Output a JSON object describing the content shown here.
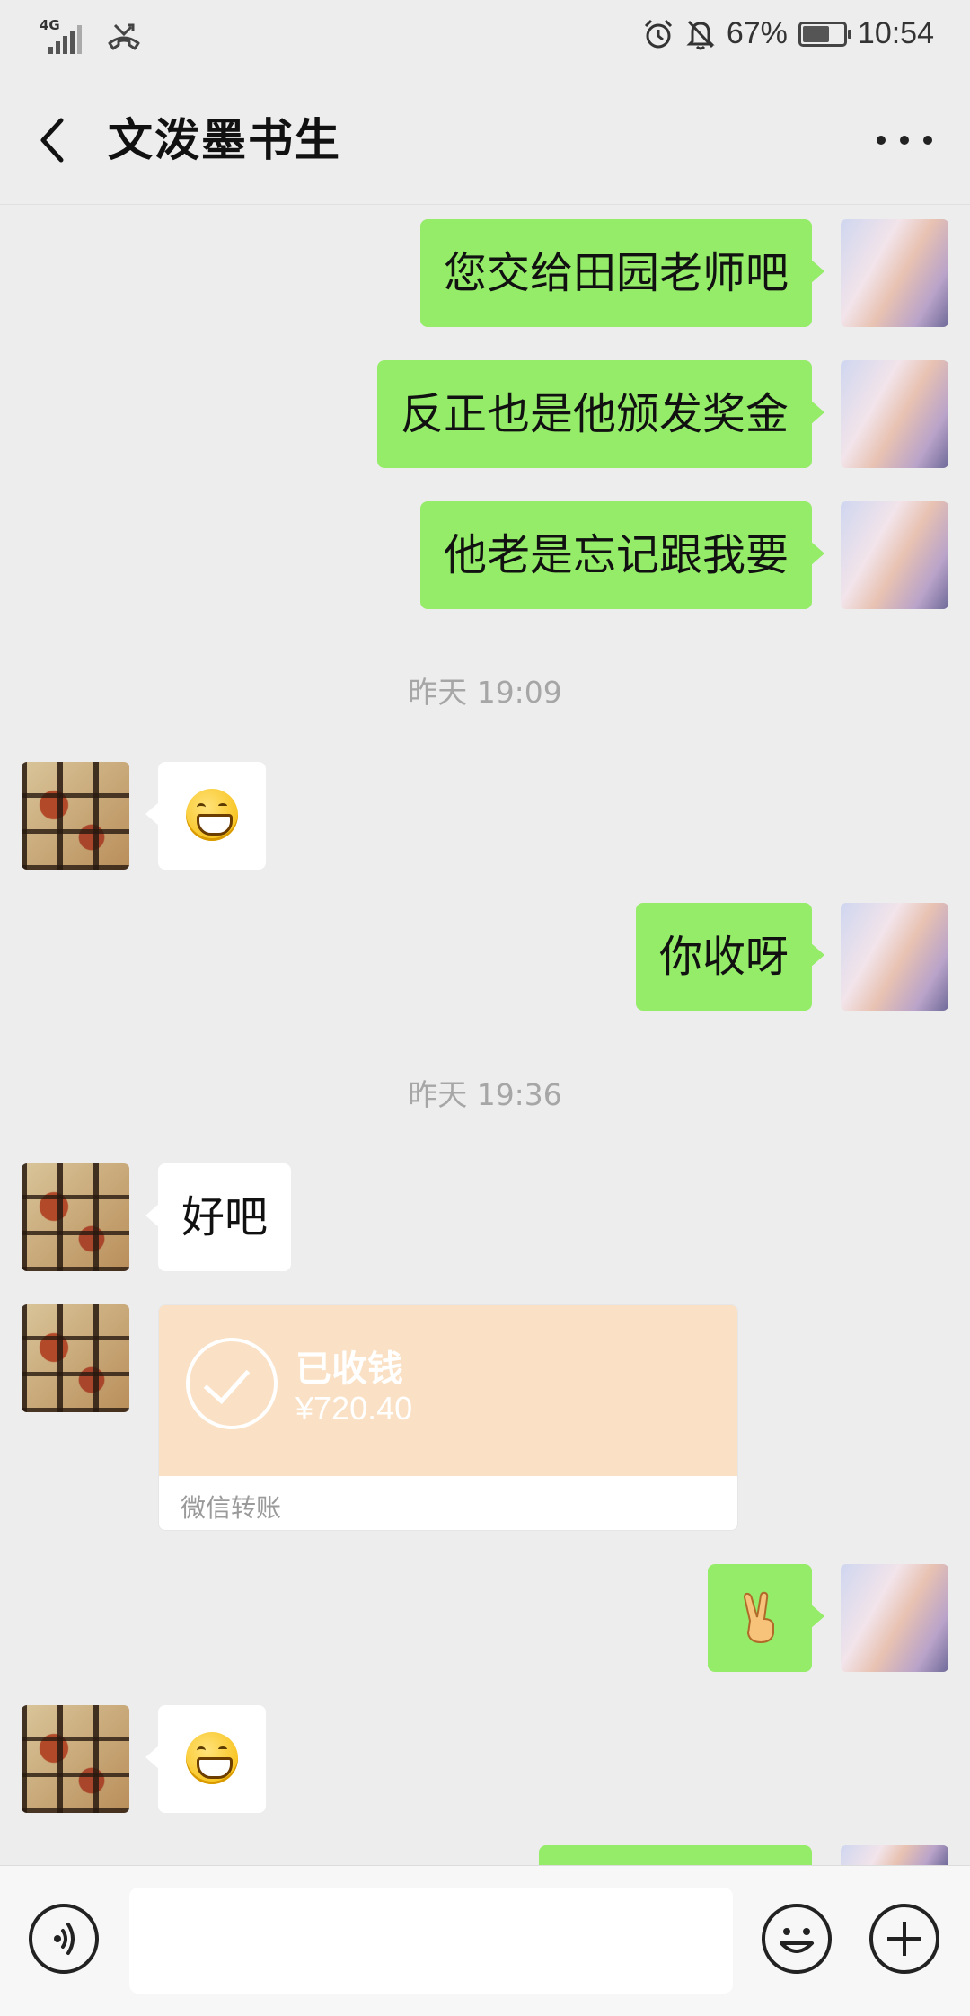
{
  "status_bar": {
    "network": "4G",
    "battery": "67%",
    "battery_level": 0.67,
    "time": "10:54"
  },
  "header": {
    "title": "文泼墨书生",
    "back_icon": "chevron-left-icon",
    "more_icon": "more-dots-icon"
  },
  "messages": [
    {
      "from": "me",
      "text": "您交给田园老师吧"
    },
    {
      "from": "me",
      "text": "反正也是他颁发奖金"
    },
    {
      "from": "me",
      "text": "他老是忘记跟我要"
    },
    {
      "timestamp": "昨天 19:09"
    },
    {
      "from": "friend",
      "emoji": "grin-emoji"
    },
    {
      "from": "me",
      "text": "你收呀"
    },
    {
      "timestamp": "昨天 19:36"
    },
    {
      "from": "friend",
      "text": "好吧"
    },
    {
      "from": "friend",
      "transfer": {
        "status": "已收钱",
        "amount": "¥720.40",
        "label": "微信转账"
      }
    },
    {
      "from": "me",
      "emoji": "victory-hand-emoji"
    },
    {
      "from": "friend",
      "emoji": "grin-emoji"
    },
    {
      "from": "me",
      "partial": true
    }
  ],
  "input_bar": {
    "voice_icon": "voice-icon",
    "emoji_icon": "emoji-icon",
    "plus_icon": "plus-icon"
  },
  "colors": {
    "my_bubble": "#95ec69",
    "friend_bubble": "#ffffff",
    "transfer_card": "#fae0c4",
    "background": "#ededed"
  }
}
